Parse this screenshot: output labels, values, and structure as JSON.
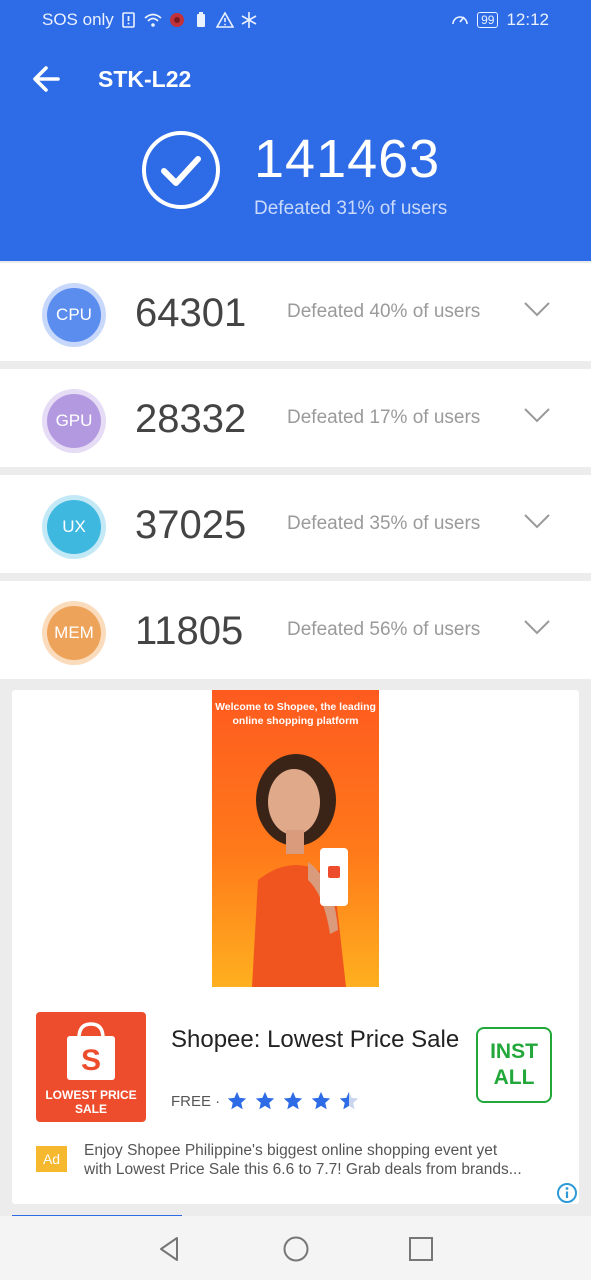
{
  "status_bar": {
    "carrier": "SOS only",
    "battery": "99",
    "time": "12:12"
  },
  "header": {
    "title": "STK-L22",
    "total_score": "141463",
    "total_defeated": "Defeated 31% of users"
  },
  "scores": [
    {
      "label": "CPU",
      "score": "64301",
      "defeated": "Defeated 40% of users",
      "color": "#5b8def",
      "ring": "#c7d8fb"
    },
    {
      "label": "GPU",
      "score": "28332",
      "defeated": "Defeated 17% of users",
      "color": "#b39ae0",
      "ring": "#e6dcf5"
    },
    {
      "label": "UX",
      "score": "37025",
      "defeated": "Defeated 35% of users",
      "color": "#3fb8e0",
      "ring": "#c4e9f6"
    },
    {
      "label": "MEM",
      "score": "11805",
      "defeated": "Defeated 56% of users",
      "color": "#eea35a",
      "ring": "#fadcbd"
    }
  ],
  "ad": {
    "banner_text": "Welcome to Shopee, the leading online shopping platform",
    "icon_text": "LOWEST PRICE SALE",
    "app_name": "Shopee: Lowest Price Sale",
    "price": "FREE ·",
    "rating": 4.5,
    "install_label": "INSTALL",
    "install_line1": "INST",
    "install_line2": "ALL",
    "tag": "Ad",
    "desc_line1": "Enjoy Shopee Philippine's biggest online shopping event yet",
    "desc_line2": "with Lowest Price Sale this 6.6 to 7.7! Grab deals from brands..."
  },
  "colors": {
    "header": "#2e6be6",
    "install": "#22a83a",
    "ad_tag": "#f5b82e",
    "star": "#2e6be6"
  }
}
